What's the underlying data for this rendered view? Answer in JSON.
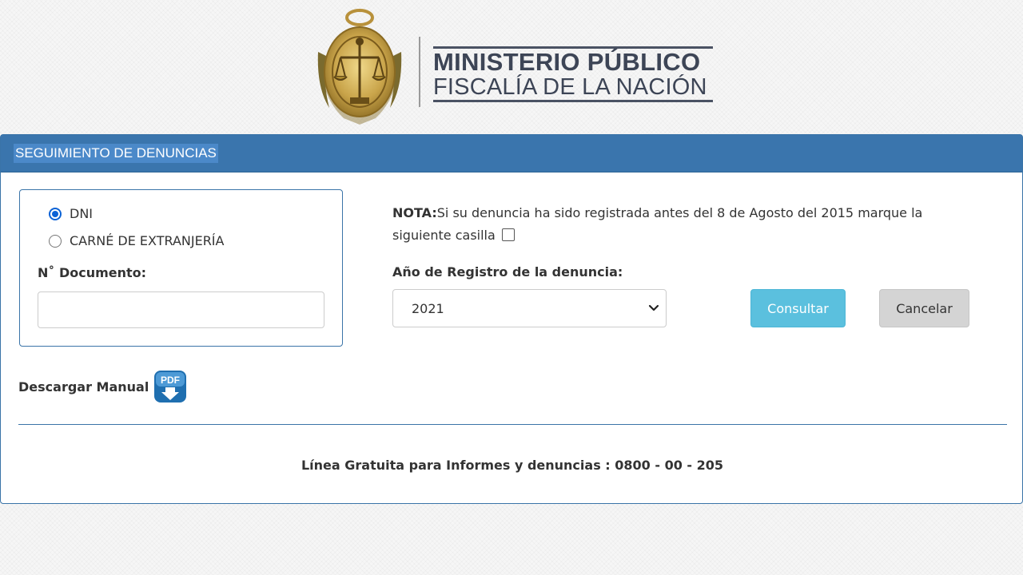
{
  "header": {
    "brand_line1": "MINISTERIO PÚBLICO",
    "brand_line2": "FISCALÍA DE LA NACIÓN"
  },
  "panel": {
    "title": "SEGUIMIENTO DE DENUNCIAS"
  },
  "document": {
    "options": [
      {
        "label": "DNI",
        "checked": true
      },
      {
        "label": "CARNÉ DE EXTRANJERÍA",
        "checked": false
      }
    ],
    "field_label": "N˚ Documento:",
    "value": ""
  },
  "note": {
    "prefix": "NOTA:",
    "text": "Si su denuncia ha sido registrada antes del 8 de Agosto del 2015 marque la siguiente casilla",
    "checkbox_checked": false
  },
  "year": {
    "label": "Año de Registro de la denuncia:",
    "selected": "2021"
  },
  "buttons": {
    "consultar": "Consultar",
    "cancelar": "Cancelar"
  },
  "manual": {
    "label": "Descargar Manual",
    "icon": "pdf-download-icon",
    "icon_text": "PDF"
  },
  "footer": {
    "hotline": "Línea Gratuita para Informes y denuncias : 0800 - 00 - 205"
  },
  "colors": {
    "panel_header": "#3a75ad",
    "consultar": "#5bc0de",
    "cancelar": "#d4d4d4",
    "brand_text": "#3d4556"
  }
}
